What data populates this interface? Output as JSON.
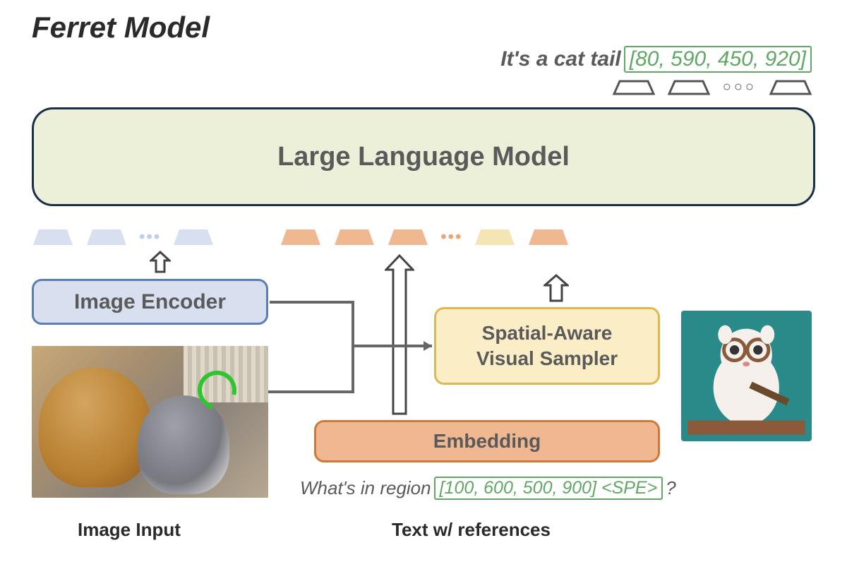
{
  "title": "Ferret Model",
  "output": {
    "prefix": "It's a cat tail",
    "coords": "[80, 590, 450, 920]"
  },
  "llm_label": "Large Language Model",
  "encoder_label": "Image Encoder",
  "sampler_line1": "Spatial-Aware",
  "sampler_line2": "Visual Sampler",
  "embedding_label": "Embedding",
  "input_text": {
    "prefix": "What's in region",
    "coords": "[100, 600, 500, 900] <SPE>",
    "suffix": "?"
  },
  "label_image_input": "Image Input",
  "label_text_ref": "Text w/ references",
  "tokens": {
    "output_dots": "○○○",
    "blue_dots": "•••",
    "orange_dots": "•••"
  }
}
